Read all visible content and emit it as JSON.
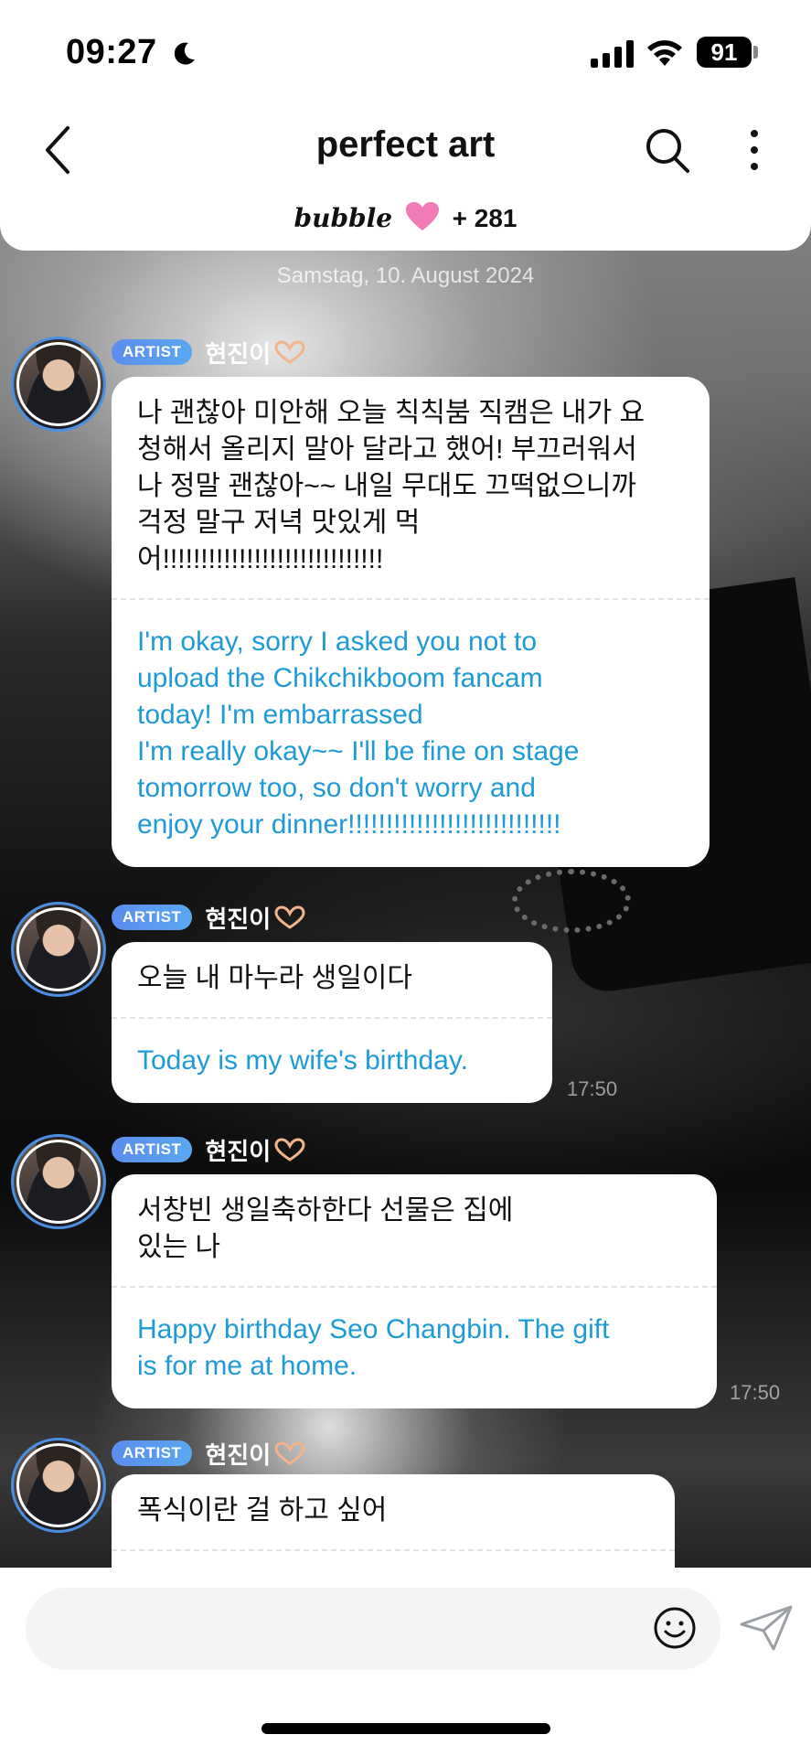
{
  "status_bar": {
    "time": "09:27",
    "battery": "91"
  },
  "header": {
    "title": "perfect art",
    "bubble_label": "bubble",
    "subscriber_count": "+ 281"
  },
  "chat": {
    "date": "Samstag, 10. August 2024",
    "messages": [
      {
        "badge": "ARTIST",
        "sender": "현진이",
        "korean": "나 괜찮아 미안해 오늘 칙칙붐 직캠은 내가 요\n청해서 올리지 말아 달라고 했어! 부끄러워서\n나 정말 괜찮아~~ 내일 무대도 끄떡없으니까\n걱정 말구 저녁 맛있게 먹\n어!!!!!!!!!!!!!!!!!!!!!!!!!!!!!",
        "english": "I'm okay, sorry I asked you not to\nupload the Chikchikboom fancam\ntoday! I'm embarrassed\nI'm really okay~~ I'll be fine on stage\ntomorrow too, so don't worry and\nenjoy your dinner!!!!!!!!!!!!!!!!!!!!!!!!!!!!",
        "time": ""
      },
      {
        "badge": "ARTIST",
        "sender": "현진이",
        "korean": "오늘 내 마누라 생일이다",
        "english": "Today is my wife's birthday.",
        "time": "17:50"
      },
      {
        "badge": "ARTIST",
        "sender": "현진이",
        "korean": "서창빈 생일축하한다 선물은 집에\n있는 나",
        "english": "Happy birthday Seo Changbin. The gift\nis for me at home.",
        "time": "17:50"
      },
      {
        "badge": "ARTIST",
        "sender": "현진이",
        "korean": "폭식이란 걸 하고 싶어",
        "english": "",
        "time": ""
      }
    ]
  },
  "composer": {
    "placeholder": ""
  },
  "icons": {
    "back": "chevron-left-icon",
    "search": "search-icon",
    "more": "more-vertical-icon",
    "heart": "heart-icon",
    "emoji": "smiley-icon",
    "send": "paper-plane-icon"
  },
  "colors": {
    "badge": "#5b8dee",
    "translation_text": "#1e9bd7",
    "avatar_ring": "#4a90e2",
    "heart": "#f07bb6"
  }
}
